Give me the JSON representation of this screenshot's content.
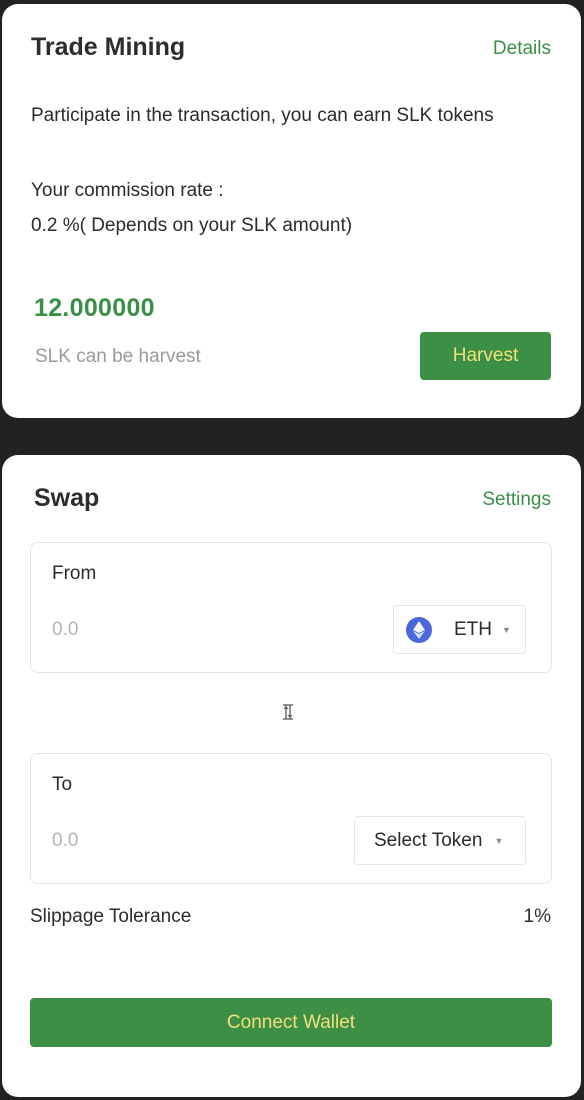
{
  "mining": {
    "title": "Trade Mining",
    "details_label": "Details",
    "description": "Participate in the transaction, you can earn SLK tokens",
    "commission_label": "Your  commission rate :",
    "commission_value": "0.2 %( Depends on your SLK amount)",
    "harvest_amount": "12.000000",
    "harvest_caption": "SLK can be harvest",
    "harvest_button": "Harvest"
  },
  "swap": {
    "title": "Swap",
    "settings_label": "Settings",
    "from": {
      "label": "From",
      "placeholder": "0.0",
      "token": "ETH",
      "token_icon": "eth-icon"
    },
    "switch_icon": "swap-direction-icon",
    "to": {
      "label": "To",
      "placeholder": "0.0",
      "token": "Select Token"
    },
    "slippage_label": "Slippage Tolerance",
    "slippage_value": "1%",
    "connect_button": "Connect Wallet"
  },
  "colors": {
    "accent": "#3a8f46",
    "button_bg": "#3d8f45",
    "button_text": "#f0e07a",
    "page_bg": "#222222",
    "card_bg": "#ffffff"
  }
}
